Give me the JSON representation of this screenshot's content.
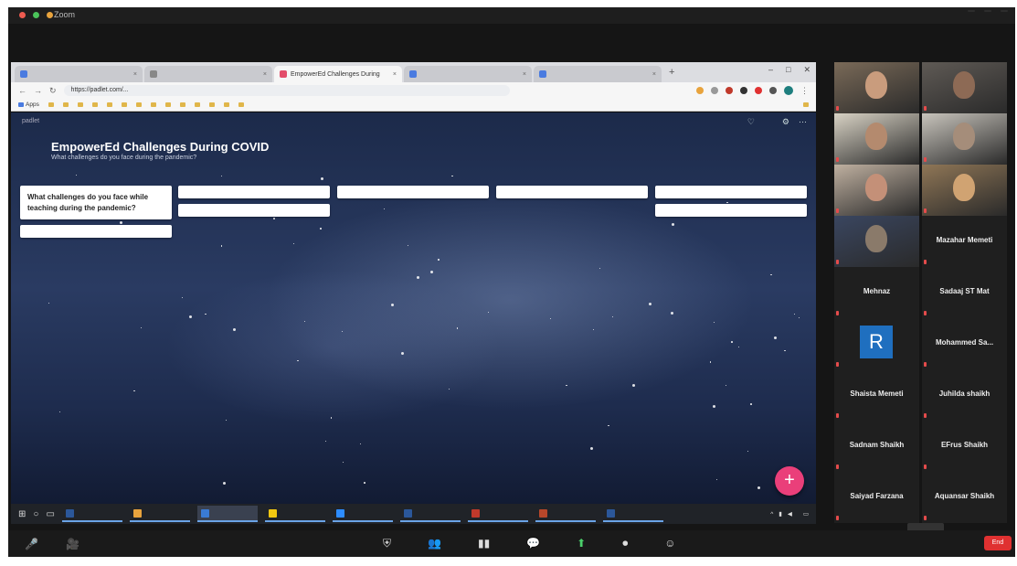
{
  "zoom": {
    "title": "Zoom",
    "top_right": [
      "",
      "",
      ""
    ]
  },
  "browser": {
    "tabs": [
      {
        "label": "",
        "color": "#4a7be0",
        "active": false
      },
      {
        "label": "",
        "color": "#888888",
        "active": false
      },
      {
        "label": "EmpowerEd Challenges During",
        "color": "#e34d6a",
        "active": true
      },
      {
        "label": "",
        "color": "#4a7be0",
        "active": false
      },
      {
        "label": "",
        "color": "#4a7be0",
        "active": false
      }
    ],
    "new_tab": "+",
    "window_controls": [
      "–",
      "□",
      "✕"
    ],
    "nav": [
      "←",
      "→",
      "↻"
    ],
    "url": "https://padlet.com/...",
    "bookmarks": [
      "Apps",
      "",
      "",
      "",
      "",
      "",
      "",
      "",
      "",
      "",
      "",
      "",
      "",
      "",
      ""
    ],
    "bookmarks_right": ""
  },
  "padlet": {
    "logo": "padlet",
    "author": "",
    "title": "EmpowerEd Challenges During COVID",
    "subtitle": "What challenges do you face during the pandemic?",
    "toolbar": [
      "♡",
      "",
      "",
      "⚙",
      "⋯"
    ],
    "columns": [
      [
        {
          "text": "What challenges do you face while teaching during the pandemic?",
          "head": true
        },
        {
          "text": "",
          "head": false
        }
      ],
      [
        {
          "text": "",
          "head": false
        },
        {
          "text": "",
          "head": false
        }
      ],
      [
        {
          "text": "",
          "head": false
        }
      ],
      [
        {
          "text": "",
          "head": false
        }
      ],
      [
        {
          "text": "",
          "head": false
        },
        {
          "text": "",
          "head": false
        }
      ]
    ],
    "fab": "+"
  },
  "taskbar": {
    "start": "⊞",
    "search": "○",
    "taskview": "▭",
    "apps": [
      {
        "label": "",
        "color": "#2b579a",
        "selected": false
      },
      {
        "label": "",
        "color": "#e8a33d",
        "selected": false
      },
      {
        "label": "",
        "color": "#3a7bd5",
        "selected": true
      },
      {
        "label": "",
        "color": "#f2c811",
        "selected": false
      },
      {
        "label": "",
        "color": "#2d8cff",
        "selected": false
      },
      {
        "label": "",
        "color": "#2b579a",
        "selected": false
      },
      {
        "label": "",
        "color": "#c0392b",
        "selected": false
      },
      {
        "label": "",
        "color": "#b7472a",
        "selected": false
      },
      {
        "label": "",
        "color": "#2b579a",
        "selected": false
      }
    ],
    "time": "",
    "date": ""
  },
  "participants": [
    {
      "name": "",
      "kind": "video",
      "active": false
    },
    {
      "name": "",
      "kind": "video",
      "active": false
    },
    {
      "name": "",
      "kind": "video",
      "active": false
    },
    {
      "name": "",
      "kind": "video",
      "active": false
    },
    {
      "name": "",
      "kind": "video",
      "active": false
    },
    {
      "name": "",
      "kind": "video",
      "active": false
    },
    {
      "name": "",
      "kind": "video",
      "active": true
    },
    {
      "name": "Mazahar Memeti",
      "kind": "name",
      "active": false
    },
    {
      "name": "Mehnaz",
      "kind": "name",
      "active": false
    },
    {
      "name": "Sadaaj ST Mat",
      "kind": "name",
      "active": false
    },
    {
      "name": "",
      "kind": "avatar",
      "letter": "R",
      "active": false
    },
    {
      "name": "Mohammed Sa...",
      "kind": "name",
      "active": false
    },
    {
      "name": "Shaista Memeti",
      "kind": "name",
      "active": false
    },
    {
      "name": "Juhilda shaikh",
      "kind": "name",
      "active": false
    },
    {
      "name": "Sadnam Shaikh",
      "kind": "name",
      "active": false
    },
    {
      "name": "EFrus Shaikh",
      "kind": "name",
      "active": false
    },
    {
      "name": "Saiyad Farzana",
      "kind": "name",
      "active": false
    },
    {
      "name": "Aquansar Shaikh",
      "kind": "name",
      "active": false
    }
  ],
  "controls": {
    "left": [
      "🎤",
      "🎥"
    ],
    "center": [
      "⛨",
      "👥",
      "▮▮",
      "💬",
      "⬆",
      "⏺",
      "☺"
    ],
    "end": "End",
    "float": ""
  }
}
